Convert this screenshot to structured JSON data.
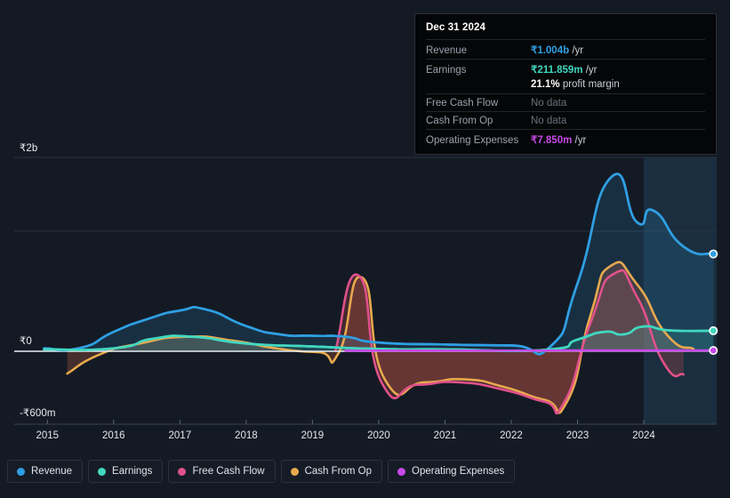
{
  "chart_data": {
    "type": "area",
    "title": "",
    "currency_symbol": "₹",
    "xlabel": "",
    "ylabel": "",
    "ylim": [
      -600000000,
      2000000000
    ],
    "y_ticks": [
      {
        "label": "₹2b",
        "value": 2000000000
      },
      {
        "label": "₹0",
        "value": 0
      },
      {
        "label": "-₹600m",
        "value": -600000000
      }
    ],
    "x_ticks": [
      "2015",
      "2016",
      "2017",
      "2018",
      "2019",
      "2020",
      "2021",
      "2022",
      "2023",
      "2024"
    ],
    "x_range": [
      "2014.5",
      "2025.1"
    ],
    "grid": true,
    "legend_position": "bottom-left",
    "highlight_band": {
      "from": "2024.0",
      "to": "2025.1",
      "label": "forecast-period"
    },
    "series": [
      {
        "name": "Revenue",
        "color": "#2f9fe3",
        "fill": "rgba(47,159,227,0.16)",
        "end_marker": true,
        "points": [
          {
            "x": "2014.95",
            "y": 30000000
          },
          {
            "x": "2015.5",
            "y": 35000000
          },
          {
            "x": "2016.0",
            "y": 200000000
          },
          {
            "x": "2016.5",
            "y": 330000000
          },
          {
            "x": "2017.0",
            "y": 420000000
          },
          {
            "x": "2017.4",
            "y": 430000000
          },
          {
            "x": "2018.0",
            "y": 260000000
          },
          {
            "x": "2018.5",
            "y": 175000000
          },
          {
            "x": "2019.0",
            "y": 160000000
          },
          {
            "x": "2019.5",
            "y": 150000000
          },
          {
            "x": "2020.0",
            "y": 90000000
          },
          {
            "x": "2021.0",
            "y": 70000000
          },
          {
            "x": "2022.0",
            "y": 60000000
          },
          {
            "x": "2022.6",
            "y": 55000000
          },
          {
            "x": "2023.0",
            "y": 700000000
          },
          {
            "x": "2023.5",
            "y": 1790000000
          },
          {
            "x": "2023.9",
            "y": 1330000000
          },
          {
            "x": "2024.15",
            "y": 1450000000
          },
          {
            "x": "2024.6",
            "y": 1080000000
          },
          {
            "x": "2025.05",
            "y": 1004000000
          }
        ]
      },
      {
        "name": "Earnings",
        "color": "#41d8c0",
        "fill": "rgba(65,216,192,0.15)",
        "end_marker": true,
        "points": [
          {
            "x": "2014.95",
            "y": 20000000
          },
          {
            "x": "2016.0",
            "y": 30000000
          },
          {
            "x": "2016.6",
            "y": 130000000
          },
          {
            "x": "2017.2",
            "y": 150000000
          },
          {
            "x": "2018.0",
            "y": 80000000
          },
          {
            "x": "2019.0",
            "y": 50000000
          },
          {
            "x": "2020.0",
            "y": 25000000
          },
          {
            "x": "2021.0",
            "y": 20000000
          },
          {
            "x": "2022.5",
            "y": 15000000
          },
          {
            "x": "2023.0",
            "y": 120000000
          },
          {
            "x": "2023.4",
            "y": 200000000
          },
          {
            "x": "2023.7",
            "y": 175000000
          },
          {
            "x": "2024.0",
            "y": 255000000
          },
          {
            "x": "2024.4",
            "y": 215000000
          },
          {
            "x": "2025.05",
            "y": 211859000
          }
        ]
      },
      {
        "name": "Free Cash Flow",
        "color": "#e0518b",
        "fill": "rgba(178,72,72,0.30)",
        "end_marker": false,
        "points": [
          {
            "x": "2019.35",
            "y": 15000000
          },
          {
            "x": "2019.7",
            "y": 780000000
          },
          {
            "x": "2020.05",
            "y": -330000000
          },
          {
            "x": "2020.6",
            "y": -345000000
          },
          {
            "x": "2021.2",
            "y": -320000000
          },
          {
            "x": "2021.9",
            "y": -400000000
          },
          {
            "x": "2022.5",
            "y": -520000000
          },
          {
            "x": "2022.8",
            "y": -525000000
          },
          {
            "x": "2023.2",
            "y": 300000000
          },
          {
            "x": "2023.55",
            "y": 800000000
          },
          {
            "x": "2023.9",
            "y": 560000000
          },
          {
            "x": "2024.3",
            "y": -120000000
          },
          {
            "x": "2024.6",
            "y": -240000000
          }
        ]
      },
      {
        "name": "Cash From Op",
        "color": "#e8a94e",
        "fill": "rgba(178,90,62,0.32)",
        "end_marker": false,
        "points": [
          {
            "x": "2015.3",
            "y": -230000000
          },
          {
            "x": "2015.8",
            "y": -30000000
          },
          {
            "x": "2016.4",
            "y": 80000000
          },
          {
            "x": "2017.1",
            "y": 150000000
          },
          {
            "x": "2017.8",
            "y": 110000000
          },
          {
            "x": "2018.5",
            "y": 25000000
          },
          {
            "x": "2019.1",
            "y": -10000000
          },
          {
            "x": "2019.4",
            "y": -12000000
          },
          {
            "x": "2019.75",
            "y": 760000000
          },
          {
            "x": "2020.1",
            "y": -300000000
          },
          {
            "x": "2020.7",
            "y": -320000000
          },
          {
            "x": "2021.3",
            "y": -290000000
          },
          {
            "x": "2021.9",
            "y": -370000000
          },
          {
            "x": "2022.5",
            "y": -500000000
          },
          {
            "x": "2022.85",
            "y": -510000000
          },
          {
            "x": "2023.2",
            "y": 380000000
          },
          {
            "x": "2023.5",
            "y": 880000000
          },
          {
            "x": "2023.9",
            "y": 690000000
          },
          {
            "x": "2024.35",
            "y": 170000000
          },
          {
            "x": "2024.75",
            "y": 25000000
          }
        ]
      },
      {
        "name": "Operating Expenses",
        "color": "#c64ae8",
        "fill": "rgba(198,74,232,0.10)",
        "end_marker": true,
        "points": [
          {
            "x": "2019.5",
            "y": 6000000
          },
          {
            "x": "2021.0",
            "y": 6500000
          },
          {
            "x": "2023.0",
            "y": 7200000
          },
          {
            "x": "2025.05",
            "y": 7850000
          }
        ]
      }
    ]
  },
  "tooltip": {
    "title": "Dec 31 2024",
    "rows": [
      {
        "label": "Revenue",
        "amount": "₹1.004b",
        "unit": "/yr",
        "color": "#2f9fe3",
        "no_data": false
      },
      {
        "label": "Earnings",
        "amount": "₹211.859m",
        "unit": "/yr",
        "color": "#41d8c0",
        "no_data": false
      }
    ],
    "profit_margin_amount": "21.1%",
    "profit_margin_text": "profit margin",
    "rows_after": [
      {
        "label": "Free Cash Flow",
        "no_data_text": "No data",
        "no_data": true
      },
      {
        "label": "Cash From Op",
        "no_data_text": "No data",
        "no_data": true
      },
      {
        "label": "Operating Expenses",
        "amount": "₹7.850m",
        "unit": "/yr",
        "color": "#c64ae8",
        "no_data": false
      }
    ]
  },
  "legend": {
    "items": [
      {
        "label": "Revenue",
        "color": "#2f9fe3"
      },
      {
        "label": "Earnings",
        "color": "#41d8c0"
      },
      {
        "label": "Free Cash Flow",
        "color": "#e0518b"
      },
      {
        "label": "Cash From Op",
        "color": "#e8a94e"
      },
      {
        "label": "Operating Expenses",
        "color": "#c64ae8"
      }
    ]
  },
  "theme": {
    "background": "#141a24",
    "grid_color": "#2b3240",
    "zero_line": "#e8edf3",
    "text_primary": "#e9edf2",
    "text_muted": "#9aa2ad",
    "highlight_band": "rgba(44,92,126,0.30)"
  }
}
